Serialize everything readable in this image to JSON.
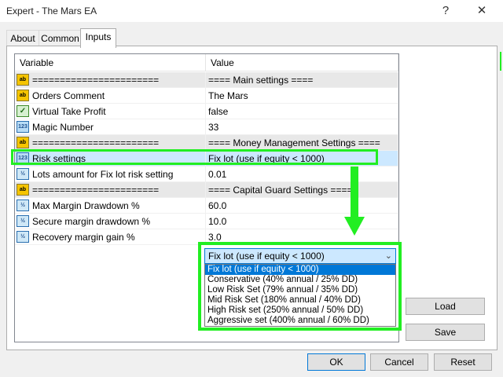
{
  "window": {
    "title": "Expert - The Mars EA",
    "help_glyph": "?",
    "close_glyph": "✕"
  },
  "tabs": [
    "About",
    "Common",
    "Inputs"
  ],
  "active_tab": "Inputs",
  "grid": {
    "headers": [
      "Variable",
      "Value"
    ],
    "rows": [
      {
        "icon": "ab-icon",
        "icon_text": "ab",
        "variable": "=======================",
        "value": "==== Main settings ===="
      },
      {
        "icon": "ab-icon",
        "icon_text": "ab",
        "variable": "Orders Comment",
        "value": "The Mars"
      },
      {
        "icon": "bool-icon",
        "icon_text": "✓",
        "variable": "Virtual Take Profit",
        "value": "false"
      },
      {
        "icon": "integer-icon",
        "icon_text": "123",
        "variable": "Magic Number",
        "value": "33"
      },
      {
        "icon": "ab-icon",
        "icon_text": "ab",
        "variable": "=======================",
        "value": "==== Money Management Settings ===="
      },
      {
        "icon": "integer-icon",
        "icon_text": "123",
        "variable": "Risk settings",
        "value": "Fix lot (use if equity < 1000)"
      },
      {
        "icon": "double-icon",
        "icon_text": "½",
        "variable": "Lots amount for Fix lot risk setting",
        "value": "0.01"
      },
      {
        "icon": "ab-icon",
        "icon_text": "ab",
        "variable": "=======================",
        "value": "==== Capital Guard Settings ===="
      },
      {
        "icon": "double-icon",
        "icon_text": "½",
        "variable": "Max Margin Drawdown %",
        "value": "60.0"
      },
      {
        "icon": "double-icon",
        "icon_text": "½",
        "variable": "Secure margin drawdown %",
        "value": "10.0"
      },
      {
        "icon": "double-icon",
        "icon_text": "½",
        "variable": "Recovery margin gain %",
        "value": "3.0"
      }
    ]
  },
  "dropdown": {
    "selected": "Fix lot (use if equity < 1000)",
    "chevron": "⌄",
    "options": [
      "Fix lot (use if equity < 1000)",
      "Conservative (40% annual / 25% DD)",
      "Low Risk Set (79% annual / 35% DD)",
      "Mid Risk Set (180% annual / 40% DD)",
      "High Risk set (250% annual / 50% DD)",
      "Aggressive set (400% annual / 60% DD)"
    ]
  },
  "side_buttons": {
    "load": "Load",
    "save": "Save"
  },
  "footer_buttons": {
    "ok": "OK",
    "cancel": "Cancel",
    "reset": "Reset"
  },
  "colors": {
    "highlight": "#22ee22",
    "selection": "#0078d7",
    "row_selected": "#cce8ff"
  }
}
